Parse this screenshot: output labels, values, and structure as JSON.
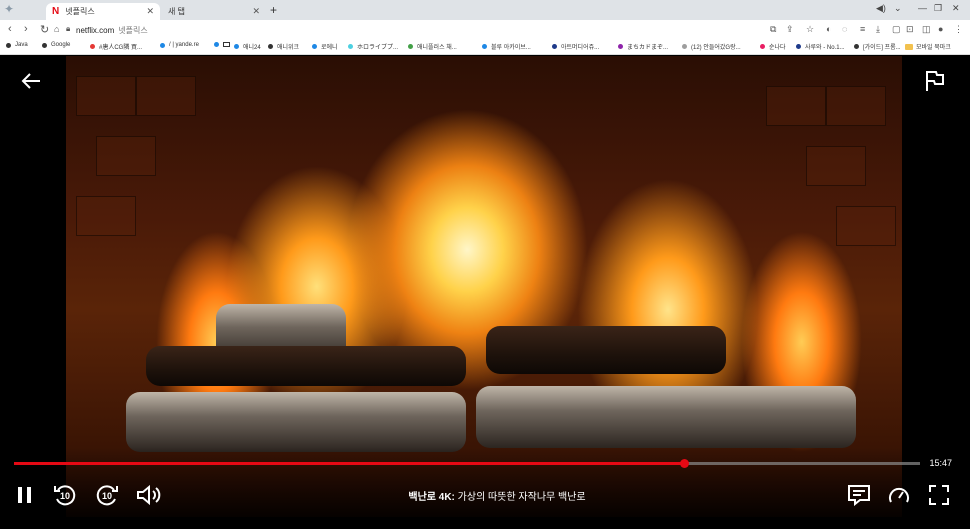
{
  "browser": {
    "tabs": [
      {
        "label": "넷플릭스",
        "active": true
      },
      {
        "label": "새 탭",
        "active": false
      }
    ],
    "new_tab": "+",
    "url_host": "netflix.com",
    "url_title": "넷플릭스",
    "bookmarks": [
      {
        "label": "Java",
        "color": "#333333"
      },
      {
        "label": "Google",
        "color": "#333333"
      },
      {
        "label": "#唐人CG隣 買...",
        "color": "#e53935"
      },
      {
        "label": "/ | yande.re",
        "color": "#1e88e5"
      },
      {
        "label": "",
        "color": "#1e88e5"
      },
      {
        "label": "애니24",
        "color": "#1e88e5"
      },
      {
        "label": "애니위크",
        "color": "#333333"
      },
      {
        "label": "로에니",
        "color": "#1e88e5"
      },
      {
        "label": "ホロライブプ...",
        "color": "#4dd0e1"
      },
      {
        "label": "애니플러스 채...",
        "color": "#43a047"
      },
      {
        "label": "블루 아카이브...",
        "color": "#1e88e5"
      },
      {
        "label": "아트머디어쥬...",
        "color": "#1e3a8a"
      },
      {
        "label": "まちカドまぞ...",
        "color": "#8e24aa"
      },
      {
        "label": "(12) 안들어갔G랑...",
        "color": "#9e9e9e"
      },
      {
        "label": "순나다",
        "color": "#e91e63"
      },
      {
        "label": "사루와 - No.1...",
        "color": "#1e3a8a"
      },
      {
        "label": "[가이드] 프롬...",
        "color": "#333333"
      }
    ],
    "bookmark_folder": "모바일 북마크"
  },
  "player": {
    "title_bold": "백난로 4K:",
    "title_rest": " 가상의 따뜻한 자작나무 백난로",
    "time_remaining": "15:47",
    "progress": 0.74,
    "skip_back_seconds": "10",
    "skip_forward_seconds": "10",
    "accent_color": "#e50914"
  }
}
